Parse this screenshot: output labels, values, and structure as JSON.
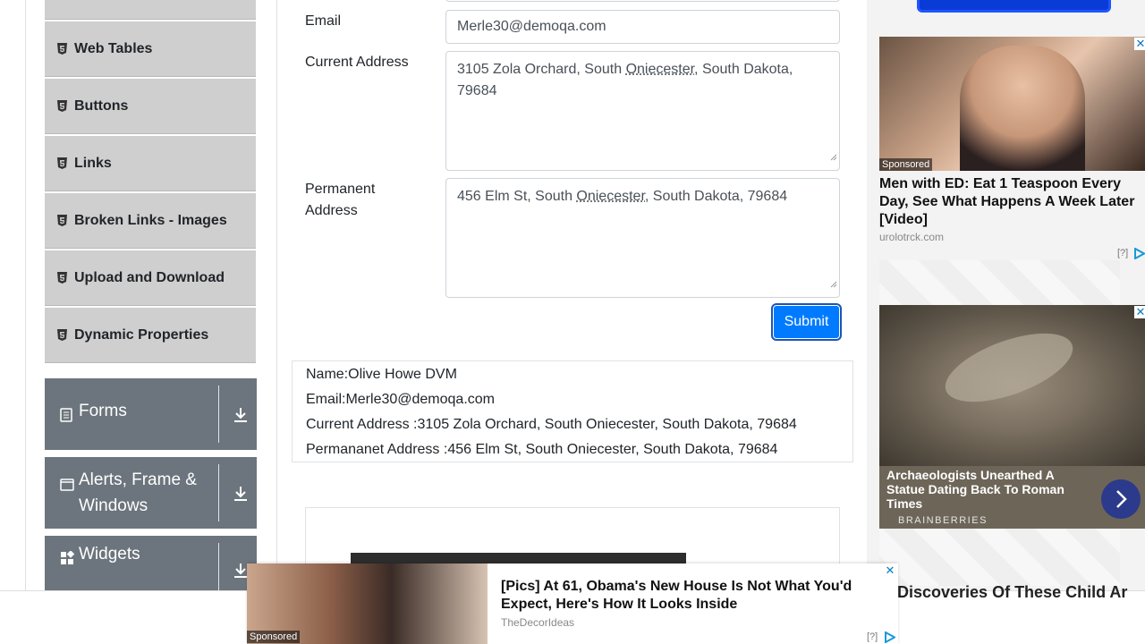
{
  "sidebar": {
    "items": [
      {
        "label": "Web Tables"
      },
      {
        "label": "Buttons"
      },
      {
        "label": "Links"
      },
      {
        "label": "Broken Links - Images"
      },
      {
        "label": "Upload and Download"
      },
      {
        "label": "Dynamic Properties"
      }
    ],
    "groups": [
      {
        "label": "Forms",
        "icon": "form-icon"
      },
      {
        "label": "Alerts, Frame & Windows",
        "icon": "window-icon"
      },
      {
        "label": "Widgets",
        "icon": "widgets-icon"
      }
    ]
  },
  "form": {
    "email_label": "Email",
    "email_value": "Merle30@demoqa.com",
    "current_address_label": "Current Address",
    "current_address_value_a": "3105 Zola Orchard, South ",
    "current_address_value_b": "Oniecester,",
    "current_address_value_c": " South Dakota, 79684",
    "permanent_address_label": "Permanent Address",
    "permanent_address_value_a": "456 Elm St, South ",
    "permanent_address_value_b": "Oniecester,",
    "permanent_address_value_c": " South Dakota, 79684",
    "submit_label": "Submit"
  },
  "output": {
    "name": "Name:Olive Howe DVM",
    "email": "Email:Merle30@demoqa.com",
    "current_address": "Current Address :3105 Zola Orchard, South Oniecester, South Dakota, 79684",
    "permanent_address": "Permananet Address :456 Elm St, South Oniecester, South Dakota, 79684"
  },
  "ads": {
    "sponsored": "Sponsored",
    "ad1_title": "Men with ED: Eat 1 Teaspoon Every Day, See What Happens A Week Later [Video]",
    "ad1_source": "urolotrck.com",
    "adchoices": "[?]",
    "ad2_title": "Archaeologists Unearthed A Statue Dating Back To Roman Times",
    "ad2_brand": "BRAINBERRIES",
    "right_bottom_text": "Discoveries Of These Child Ar",
    "bottom_title": "[Pics] At 61, Obama's New House Is Not What You'd Expect, Here's How It Looks Inside",
    "bottom_source": "TheDecorIdeas",
    "close": "✕"
  },
  "colors": {
    "primary": "#007bff",
    "sidebar_item": "#cfcfcf",
    "group_bg": "#6c757d"
  }
}
